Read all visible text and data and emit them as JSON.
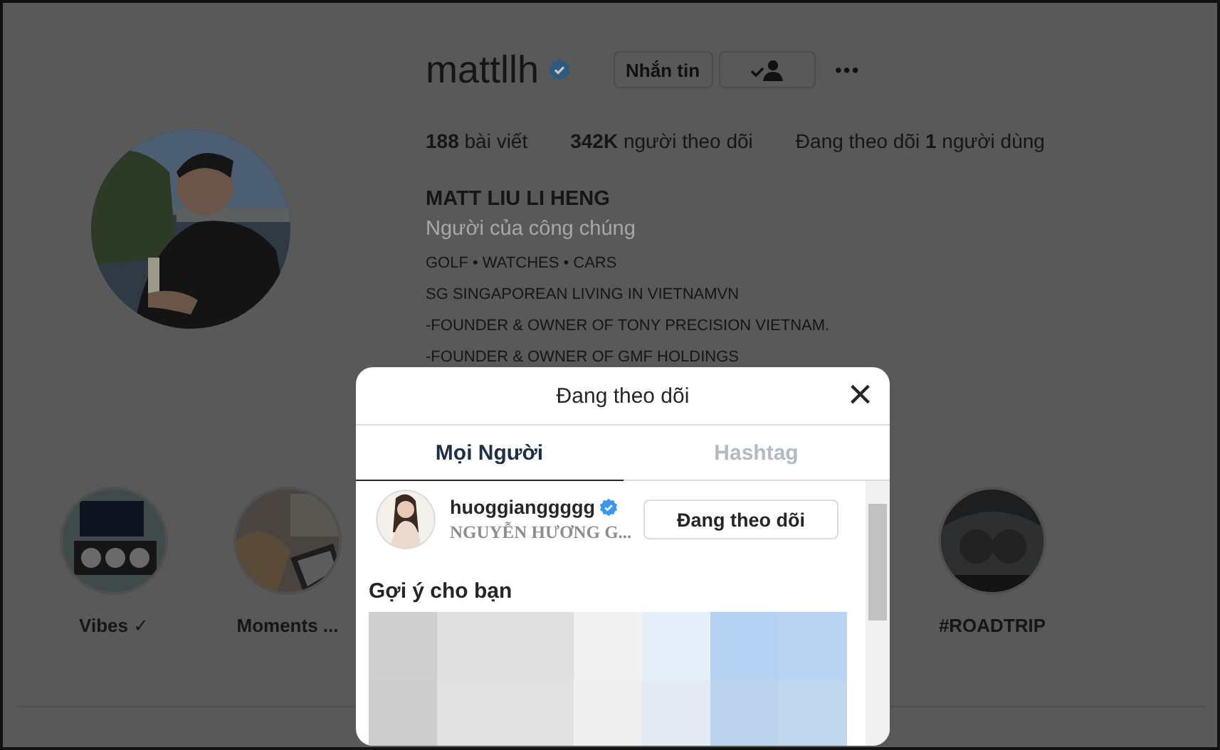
{
  "profile": {
    "username": "mattllh",
    "verified": true,
    "message_button": "Nhắn tin",
    "more_button": "•••",
    "stats": [
      "**188** bài viết",
      "**342K** người theo dõi",
      "Đang theo dõi **1** người dùng"
    ],
    "full_name": "MATT LIU LI HENG",
    "category": "Người của công chúng",
    "bio": [
      "GOLF • WATCHES • CARS",
      "SG SINGAPOREAN LIVING IN VIETNAMVN",
      "-FOUNDER & OWNER OF TONY PRECISION VIETNAM.",
      "-FOUNDER & OWNER OF GMF HOLDINGS"
    ]
  },
  "highlights": [
    {
      "label": "Vibes ✓"
    },
    {
      "label": "Moments ..."
    },
    {
      "label": "#ROADTRIP"
    }
  ],
  "modal": {
    "title": "Đang theo dõi",
    "close": "×",
    "tabs": [
      {
        "label": "Mọi Người",
        "selected": true
      },
      {
        "label": "Hashtag",
        "selected": false
      }
    ],
    "following": [
      {
        "username": "huoggianggggg",
        "verified": true,
        "full_name": "NGUYỄN HƯƠNG G...",
        "button": "Đang theo dõi"
      }
    ],
    "suggestions_heading": "Gợi ý cho bạn"
  }
}
